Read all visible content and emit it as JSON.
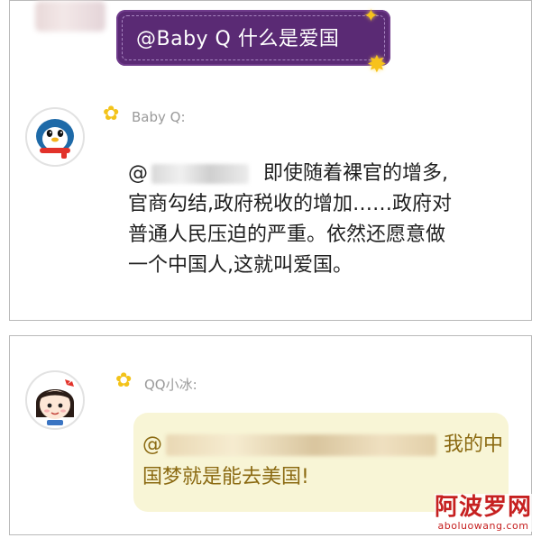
{
  "chat": {
    "user_message": "@Baby Q 什么是爱国",
    "babyq": {
      "sender": "Baby Q:",
      "reply_prefix": "@",
      "reply_body": "即使随着裸官的增多,官商勾结,政府税收的增加……政府对普通人民压迫的严重。依然还愿意做一个中国人,这就叫爱国。"
    },
    "xiaobing": {
      "sender": "QQ小冰:",
      "reply_prefix": "@",
      "reply_suffix": "我的中国梦就是能去美国!"
    }
  },
  "watermark": {
    "site_name": "阿波罗网",
    "site_url": "aboluowang.com"
  },
  "icons": {
    "sparkle": "sparkle-icon",
    "flower": "flower-icon",
    "penguin_avatar": "penguin-avatar-icon",
    "girl_avatar": "girl-avatar-icon"
  },
  "colors": {
    "purple_bubble": "#5a2a74",
    "yellow_bubble": "#f8f5d6",
    "yellow_text": "#8b6a12",
    "watermark": "#c62020"
  }
}
